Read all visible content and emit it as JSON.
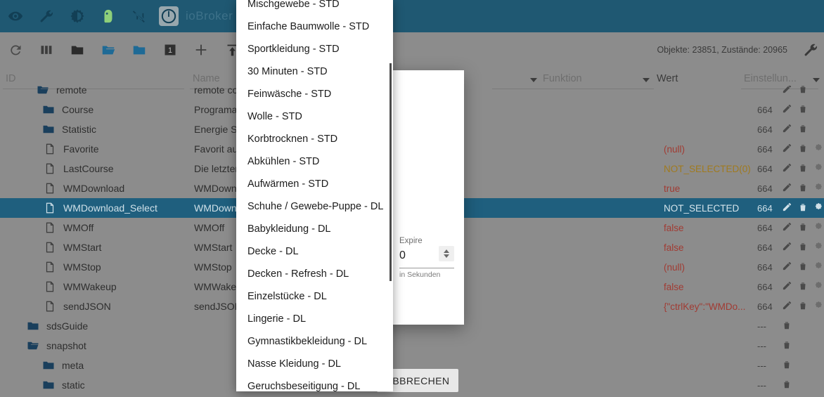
{
  "appbar": {
    "brand": "ioBroker",
    "icons": [
      {
        "name": "eye-icon"
      },
      {
        "name": "wrench-icon"
      },
      {
        "name": "contrast-icon"
      },
      {
        "name": "person-icon"
      },
      {
        "name": "connection-off-icon"
      },
      {
        "name": "power-icon"
      }
    ]
  },
  "toolbar": {
    "icons": [
      {
        "name": "refresh-icon"
      },
      {
        "name": "columns-icon"
      },
      {
        "name": "folder-closed-icon"
      },
      {
        "name": "folder-open-icon"
      },
      {
        "name": "folder-filled-icon"
      },
      {
        "name": "expand-level-1-icon",
        "label": "1"
      },
      {
        "name": "plus-icon"
      },
      {
        "name": "import-icon"
      }
    ],
    "counts": "Objekte: 23851, Zustände: 20965",
    "settings_icon": "wrench-icon"
  },
  "columns": {
    "id": "ID",
    "name": "Name",
    "funktion": "Funktion",
    "wert": "Wert",
    "einstellungen": "Einstellun..."
  },
  "rows": [
    {
      "id": "remote",
      "icon": "folder-open-icon",
      "indent": 52,
      "name": "remote co",
      "value": "",
      "value_class": "",
      "perm": "",
      "actions": [
        "edit",
        "delete"
      ],
      "selected": false,
      "partial": true
    },
    {
      "id": "Course",
      "icon": "folder-closed-icon",
      "indent": 60,
      "name": "Programau",
      "value": "",
      "value_class": "",
      "perm": "664",
      "actions": [
        "edit",
        "delete"
      ],
      "selected": false
    },
    {
      "id": "Statistic",
      "icon": "folder-closed-icon",
      "indent": 60,
      "name": "Energie St",
      "value": "",
      "value_class": "",
      "perm": "664",
      "actions": [
        "edit",
        "delete"
      ],
      "selected": false
    },
    {
      "id": "Favorite",
      "icon": "file-icon",
      "indent": 62,
      "name": "Favorit aus",
      "value": "(null)",
      "value_class": "v-red",
      "perm": "664",
      "actions": [
        "edit",
        "delete",
        "gear"
      ],
      "selected": false
    },
    {
      "id": "LastCourse",
      "icon": "file-icon",
      "indent": 62,
      "name": "Die letzten",
      "value": "NOT_SELECTED(0)",
      "value_class": "v-amber",
      "perm": "664",
      "actions": [
        "edit",
        "delete",
        "gear"
      ],
      "selected": false
    },
    {
      "id": "WMDownload",
      "icon": "file-icon",
      "indent": 62,
      "name": "WMDownl",
      "value": "true",
      "value_class": "v-red",
      "perm": "664",
      "actions": [
        "edit",
        "delete",
        "gear"
      ],
      "selected": false
    },
    {
      "id": "WMDownload_Select",
      "icon": "file-icon",
      "indent": 62,
      "name": "WMDownl",
      "value": "NOT_SELECTED",
      "value_class": "v-sel",
      "perm": "664",
      "actions": [
        "edit",
        "delete",
        "gear"
      ],
      "selected": true
    },
    {
      "id": "WMOff",
      "icon": "file-icon",
      "indent": 62,
      "name": "WMOff",
      "value": "false",
      "value_class": "v-red",
      "perm": "664",
      "actions": [
        "edit",
        "delete",
        "gear"
      ],
      "selected": false
    },
    {
      "id": "WMStart",
      "icon": "file-icon",
      "indent": 62,
      "name": "WMStart",
      "value": "false",
      "value_class": "v-red",
      "perm": "664",
      "actions": [
        "edit",
        "delete",
        "gear"
      ],
      "selected": false
    },
    {
      "id": "WMStop",
      "icon": "file-icon",
      "indent": 62,
      "name": "WMStop",
      "value": "(null)",
      "value_class": "v-red",
      "perm": "664",
      "actions": [
        "edit",
        "delete",
        "gear"
      ],
      "selected": false
    },
    {
      "id": "WMWakeup",
      "icon": "file-icon",
      "indent": 62,
      "name": "WMWakeu",
      "value": "false",
      "value_class": "v-red",
      "perm": "664",
      "actions": [
        "edit",
        "delete",
        "gear"
      ],
      "selected": false
    },
    {
      "id": "sendJSON",
      "icon": "file-icon",
      "indent": 62,
      "name": "sendJSON",
      "value": "{\"ctrlKey\":\"WMDo...",
      "value_class": "v-red",
      "perm": "664",
      "actions": [
        "edit",
        "delete",
        "gear"
      ],
      "selected": false
    },
    {
      "id": "sdsGuide",
      "icon": "folder-closed-icon",
      "indent": 38,
      "name": "",
      "value": "",
      "value_class": "",
      "perm": "---",
      "actions": [
        "delete"
      ],
      "selected": false
    },
    {
      "id": "snapshot",
      "icon": "folder-open-icon",
      "indent": 38,
      "name": "",
      "value": "",
      "value_class": "",
      "perm": "---",
      "actions": [
        "delete"
      ],
      "selected": false
    },
    {
      "id": "meta",
      "icon": "folder-closed-icon",
      "indent": 60,
      "name": "",
      "value": "",
      "value_class": "",
      "perm": "---",
      "actions": [
        "delete"
      ],
      "selected": false
    },
    {
      "id": "static",
      "icon": "folder-closed-icon",
      "indent": 60,
      "name": "",
      "value": "",
      "value_class": "",
      "perm": "---",
      "actions": [
        "delete"
      ],
      "selected": false
    }
  ],
  "dialog": {
    "expire_label": "Expire",
    "expire_value": "0",
    "expire_hint": "in Sekunden",
    "cancel_label": "ABBRECHEN"
  },
  "dropdown": {
    "items": [
      "Mischgewebe - STD",
      "Einfache Baumwolle - STD",
      "Sportkleidung - STD",
      "30 Minuten - STD",
      "Feinwäsche - STD",
      "Wolle - STD",
      "Korbtrocknen - STD",
      "Abkühlen - STD",
      "Aufwärmen - STD",
      "Schuhe / Gewebe-Puppe - DL",
      "Babykleidung - DL",
      "Decke - DL",
      "Decken - Refresh - DL",
      "Einzelstücke - DL",
      "Lingerie - DL",
      "Gymnastikbekleidung - DL",
      "Nasse Kleidung - DL",
      "Geruchsbeseitigung - DL"
    ]
  },
  "colors": {
    "appbar": "#1f5872",
    "selection": "#1f5f7e",
    "folder": "#1a3f5c",
    "folder_open": "#1e6a96",
    "value_red": "#a13b33",
    "value_amber": "#a07a1e",
    "background": "#8c8c8c"
  }
}
